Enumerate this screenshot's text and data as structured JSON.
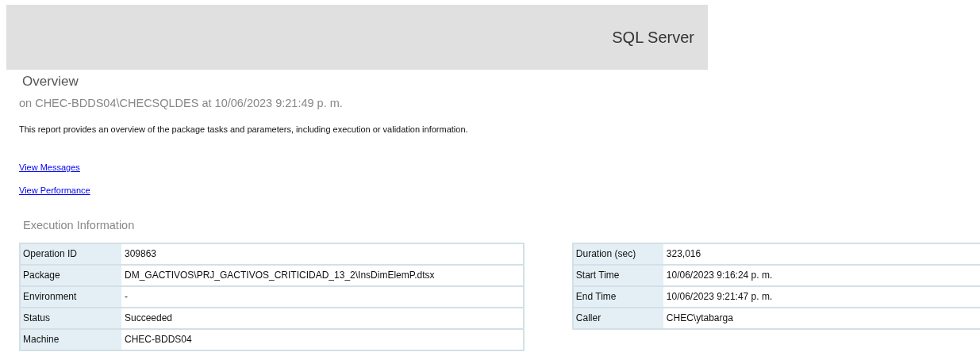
{
  "header": {
    "title": "SQL Server"
  },
  "overview": {
    "title": "Overview",
    "subtitle": "on CHEC-BDDS04\\CHECSQLDES at 10/06/2023 9:21:49 p. m.",
    "description": "This report provides an overview of the package tasks and parameters, including execution or validation information."
  },
  "links": [
    "View Messages",
    "View Performance"
  ],
  "execution_information": {
    "title": "Execution Information",
    "left_table": [
      {
        "label": "Operation ID",
        "value": "309863"
      },
      {
        "label": "Package",
        "value": "DM_GACTIVOS\\PRJ_GACTIVOS_CRITICIDAD_13_2\\InsDimElemP.dtsx"
      },
      {
        "label": "Environment",
        "value": "-"
      },
      {
        "label": "Status",
        "value": "Succeeded"
      },
      {
        "label": "Machine",
        "value": "CHEC-BDDS04"
      }
    ],
    "right_table": [
      {
        "label": "Duration (sec)",
        "value": "323,016"
      },
      {
        "label": "Start Time",
        "value": "10/06/2023 9:16:24 p. m."
      },
      {
        "label": "End Time",
        "value": "10/06/2023 9:21:47 p. m."
      },
      {
        "label": "Caller",
        "value": "CHEC\\ytabarga"
      }
    ]
  }
}
